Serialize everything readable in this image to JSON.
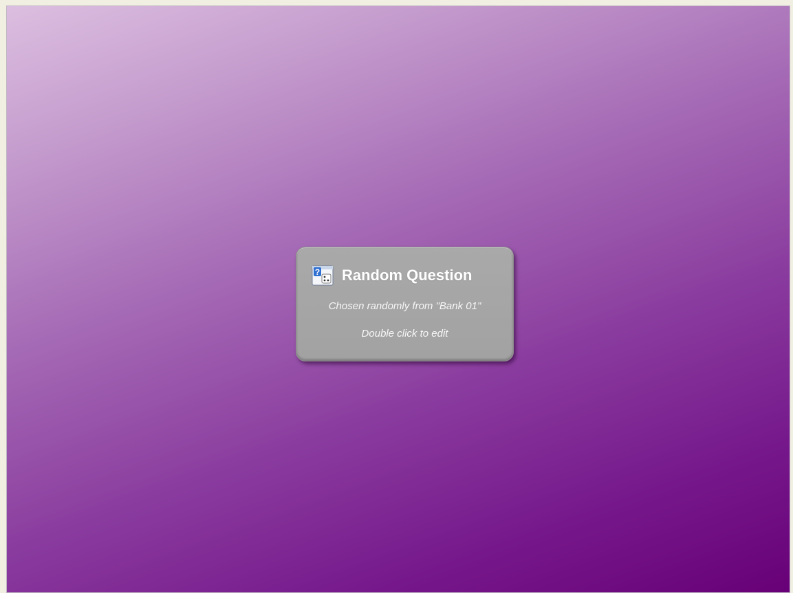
{
  "colors": {
    "background_top": "#dcbfe0",
    "background_bottom": "#680077",
    "card": "#a6a6a6",
    "card_text": "#ffffff"
  },
  "question_card": {
    "icon": "random-question-icon",
    "title": "Random Question",
    "subtitle": "Chosen randomly from \"Bank 01\"",
    "hint": "Double click to edit"
  }
}
